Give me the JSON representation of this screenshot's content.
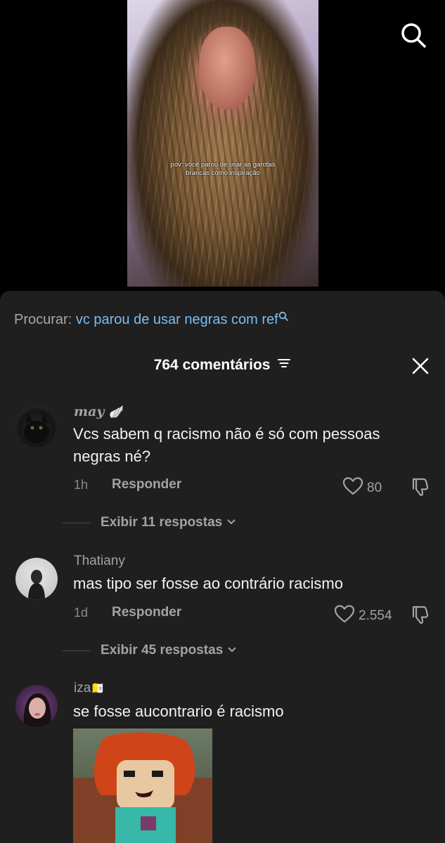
{
  "video": {
    "caption": "pov: você parou de usar as garotas brancas como inspiração"
  },
  "search_bar": {
    "prefix": "Procurar:",
    "query": "vc parou de usar negras com ref"
  },
  "comments_header": {
    "title": "764 comentários"
  },
  "comments": [
    {
      "username": "may",
      "username_emoji": "🪽",
      "text": "Vcs sabem q racismo não é só com pessoas negras né?",
      "time": "1h",
      "reply_label": "Responder",
      "likes": "80",
      "view_replies": "Exibir 11 respostas"
    },
    {
      "username": "Thatiany",
      "text": "mas tipo ser fosse ao contrário racismo",
      "time": "1d",
      "reply_label": "Responder",
      "likes": "2.554",
      "view_replies": "Exibir 45 respostas"
    },
    {
      "username": "iza",
      "username_emoji": "🇻🇦",
      "text": "se fosse aucontrario é racismo"
    }
  ],
  "colors": {
    "sheet_bg": "#1f1f1f",
    "search_query": "#7cbcf0",
    "muted_text": "#a3a3a3"
  },
  "icons": [
    "search-icon",
    "close-icon",
    "filter-icon",
    "heart-icon",
    "thumbs-down-icon",
    "chevron-down-icon"
  ]
}
